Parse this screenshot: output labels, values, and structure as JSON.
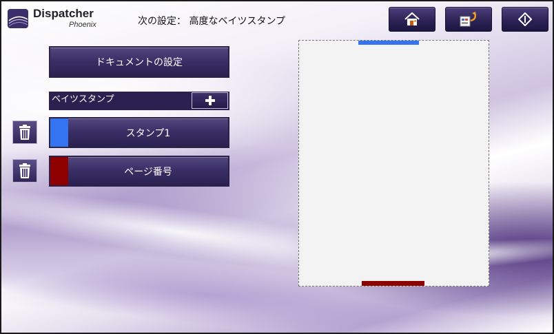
{
  "app": {
    "logo_title": "Dispatcher",
    "logo_subtitle": "Phoenix"
  },
  "header": {
    "title": "次の設定： 高度なベイツスタンプ",
    "buttons": [
      {
        "name": "home",
        "icon": "home-icon"
      },
      {
        "name": "reset",
        "icon": "reset-icon"
      },
      {
        "name": "start",
        "icon": "start-icon"
      }
    ]
  },
  "left_panel": {
    "document_settings_label": "ドキュメントの設定",
    "stamps_header_label": "ベイツスタンプ",
    "add_icon": "plus-icon",
    "stamps": [
      {
        "label": "スタンプ1",
        "color": "#3574f0",
        "delete_icon": "trash-icon"
      },
      {
        "label": "ページ番号",
        "color": "#8e0000",
        "delete_icon": "trash-icon"
      }
    ]
  },
  "preview": {
    "top_marker_color": "#3574f0",
    "bottom_marker_color": "#8e0000"
  },
  "colors": {
    "button_dark": "#2a2150",
    "accent_blue": "#3574f0",
    "accent_red": "#8e0000"
  }
}
